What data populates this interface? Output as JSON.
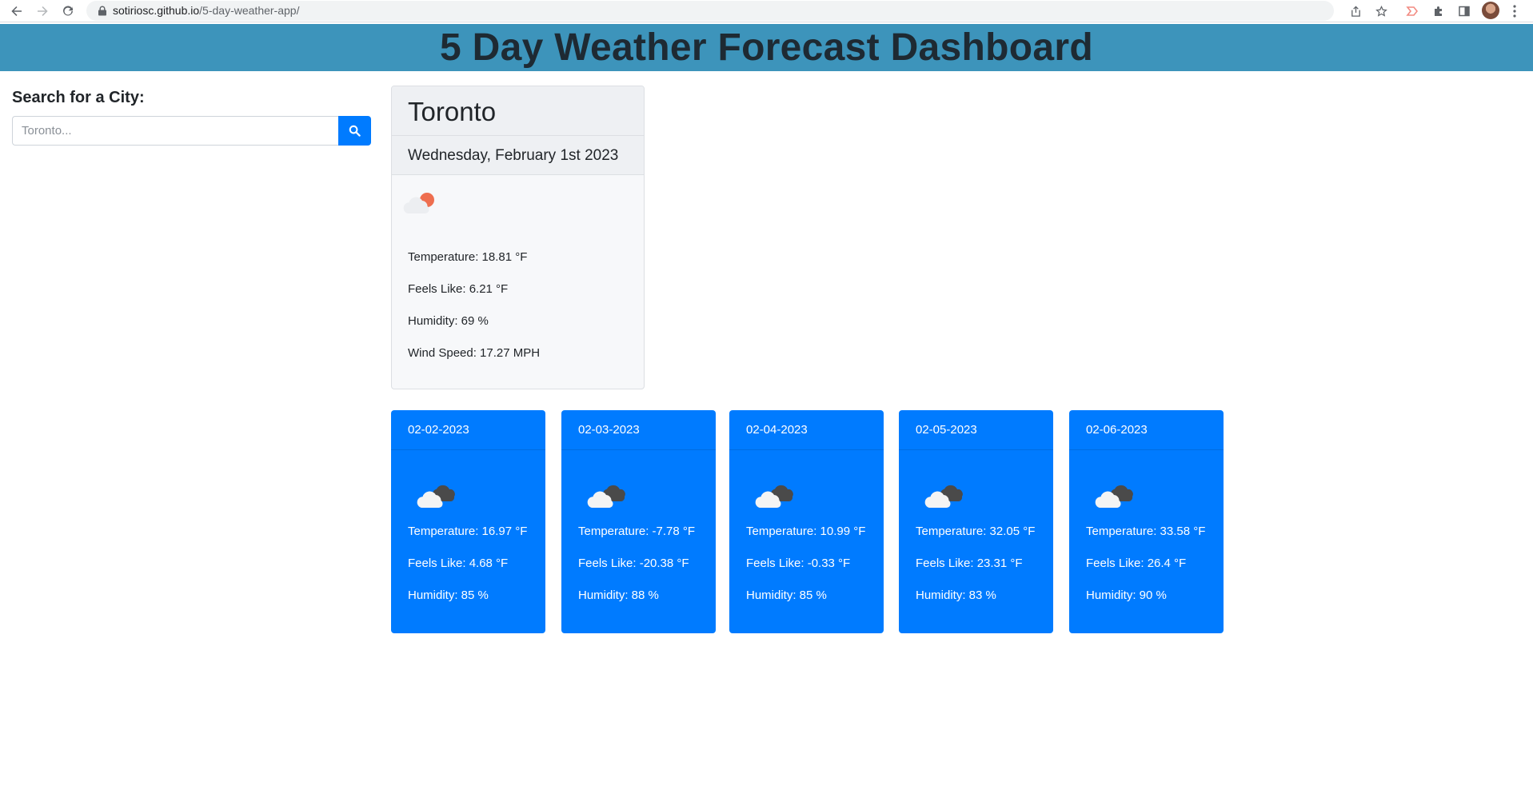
{
  "browser": {
    "url_domain": "sotiriosc.github.io",
    "url_path": "/5-day-weather-app/"
  },
  "header": {
    "title": "5 Day Weather Forecast Dashboard"
  },
  "search": {
    "label": "Search for a City:",
    "placeholder": "Toronto...",
    "value": "",
    "button_icon": "search-icon"
  },
  "current": {
    "city": "Toronto",
    "date": "Wednesday, February 1st 2023",
    "icon": "partly-cloudy-sun-icon",
    "temperature": "Temperature: 18.81 °F",
    "feels_like": "Feels Like: 6.21 °F",
    "humidity": "Humidity: 69 %",
    "wind_speed": "Wind Speed: 17.27 MPH"
  },
  "forecast": [
    {
      "date": "02-02-2023",
      "icon": "broken-clouds-icon",
      "temperature": "Temperature: 16.97 °F",
      "feels_like": "Feels Like: 4.68 °F",
      "humidity": "Humidity: 85 %"
    },
    {
      "date": "02-03-2023",
      "icon": "broken-clouds-icon",
      "temperature": "Temperature: -7.78 °F",
      "feels_like": "Feels Like: -20.38 °F",
      "humidity": "Humidity: 88 %"
    },
    {
      "date": "02-04-2023",
      "icon": "broken-clouds-icon",
      "temperature": "Temperature: 10.99 °F",
      "feels_like": "Feels Like: -0.33 °F",
      "humidity": "Humidity: 85 %"
    },
    {
      "date": "02-05-2023",
      "icon": "broken-clouds-icon",
      "temperature": "Temperature: 32.05 °F",
      "feels_like": "Feels Like: 23.31 °F",
      "humidity": "Humidity: 83 %"
    },
    {
      "date": "02-06-2023",
      "icon": "broken-clouds-icon",
      "temperature": "Temperature: 33.58 °F",
      "feels_like": "Feels Like: 26.4 °F",
      "humidity": "Humidity: 90 %"
    }
  ],
  "colors": {
    "header_bg": "#3d94bb",
    "forecast_bg": "#007bff",
    "search_button_bg": "#007bff",
    "sun_accent": "#ee6e4f"
  }
}
